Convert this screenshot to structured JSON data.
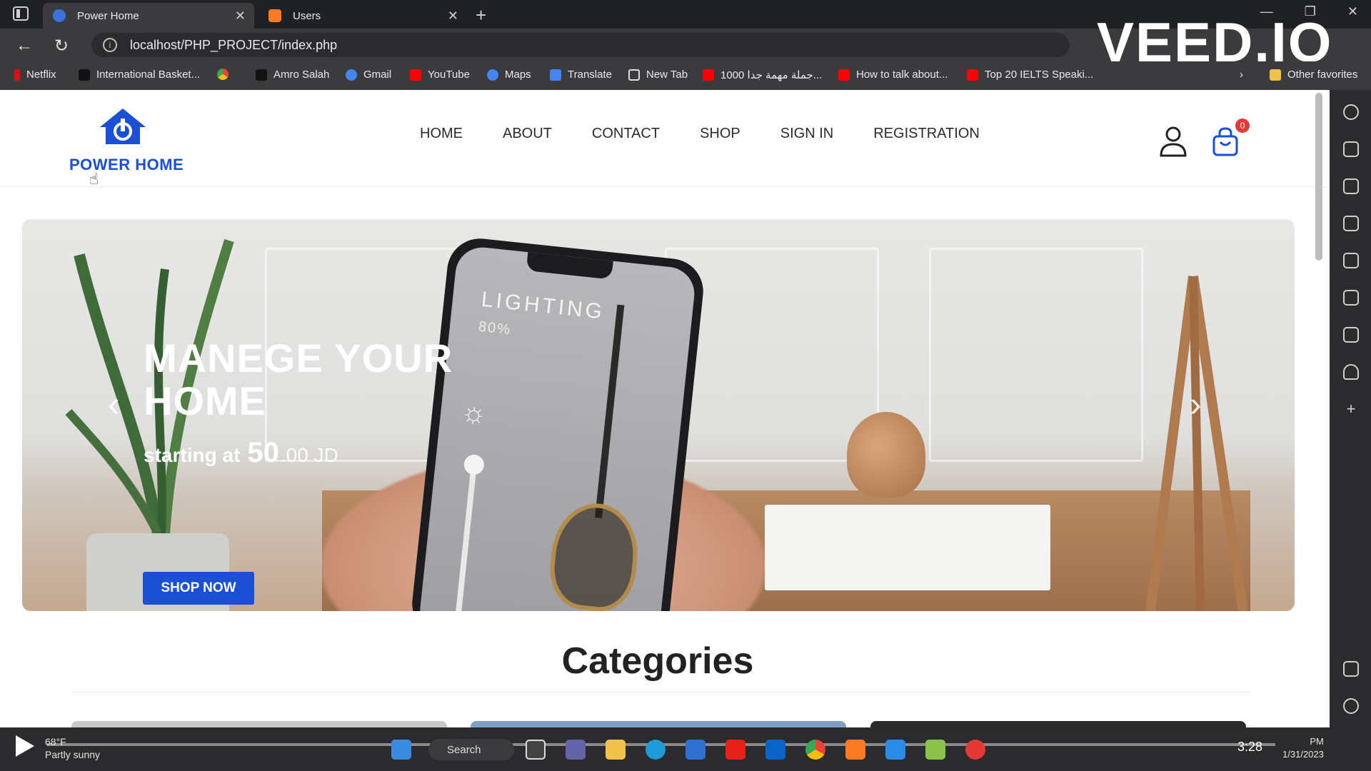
{
  "browser": {
    "tabs": [
      {
        "title": "Power Home",
        "active": true
      },
      {
        "title": "Users",
        "active": false
      }
    ],
    "url": "localhost/PHP_PROJECT/index.php",
    "bookmarks": [
      "Netflix",
      "International Basket...",
      "Amro Salah",
      "Gmail",
      "YouTube",
      "Maps",
      "Translate",
      "New Tab",
      "1000 جملة مهمة جدا...",
      "How to talk about...",
      "Top 20 IELTS Speaki..."
    ],
    "other_favorites": "Other favorites",
    "watermark": "VEED.IO"
  },
  "site": {
    "logo_text": "POWER HOME",
    "nav": [
      "HOME",
      "ABOUT",
      "CONTACT",
      "SHOP",
      "SIGN IN",
      "REGISTRATION"
    ],
    "cart_count": "0",
    "hero": {
      "title": "MANEGE YOUR HOME",
      "starting": "starting at",
      "price_big": "50",
      "price_rest": ".00 JD",
      "button": "SHOP NOW",
      "phone_label": "LIGHTING",
      "phone_value": "80%"
    },
    "categories_title": "Categories"
  },
  "colors": {
    "brand_blue": "#1a4fd6",
    "badge_red": "#e53935"
  },
  "taskbar": {
    "weather_temp": "68°F",
    "weather_desc": "Partly sunny",
    "search": "Search",
    "timecode": "3:28",
    "clock_time": "PM",
    "clock_date": "1/31/2023"
  }
}
